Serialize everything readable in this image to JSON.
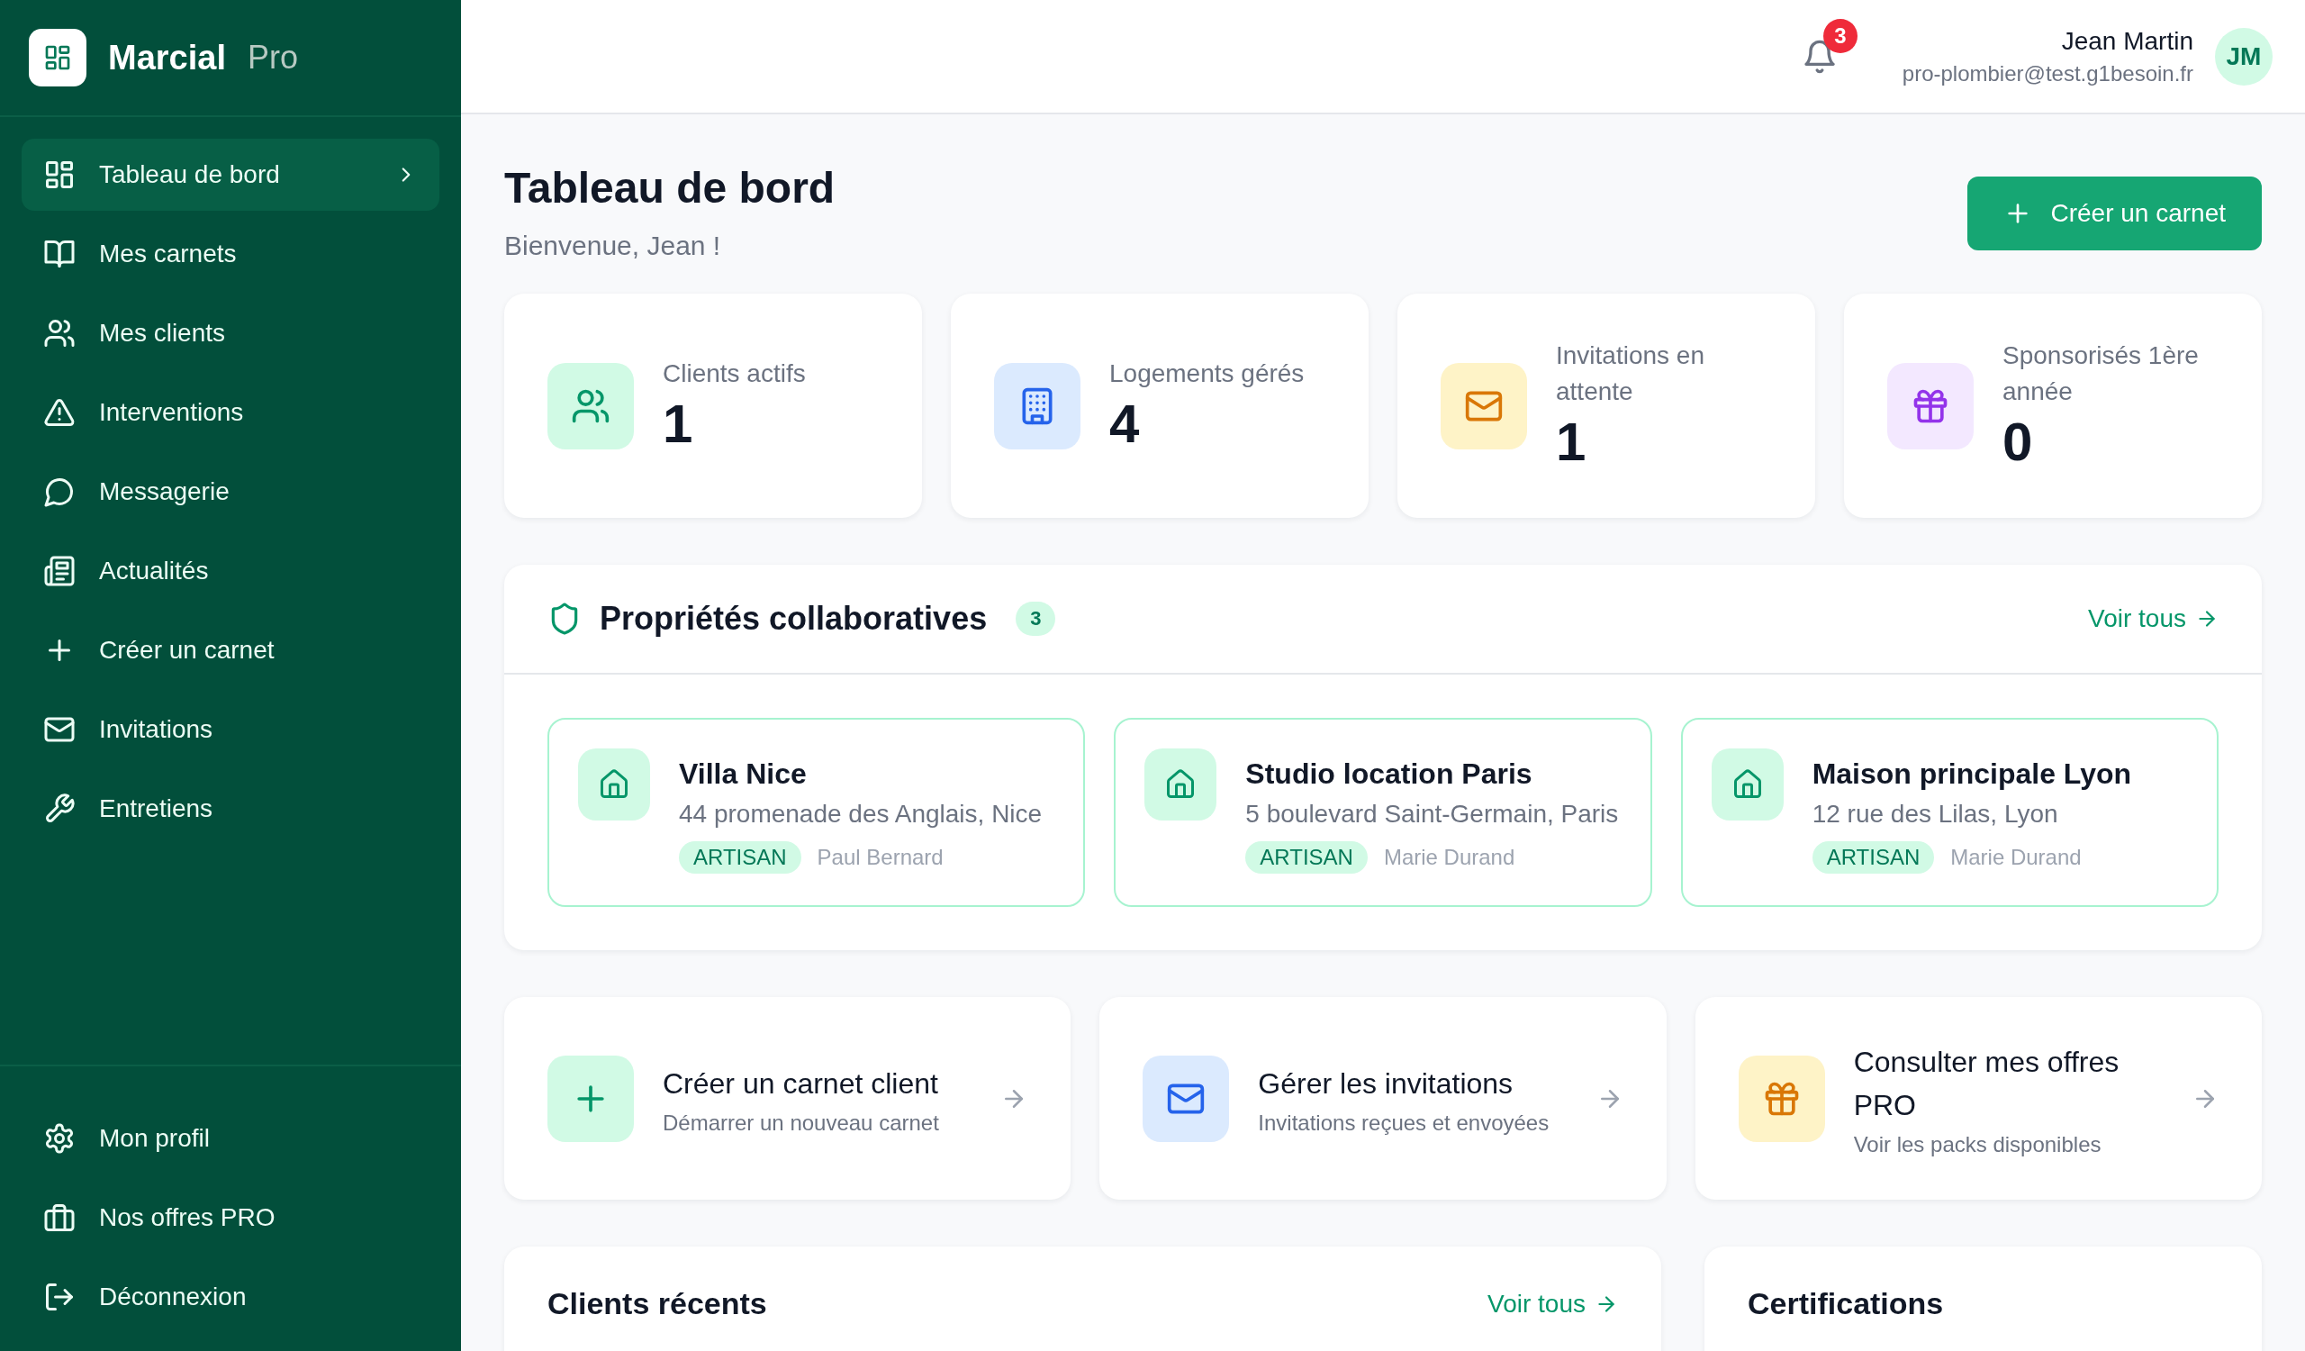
{
  "sidebar": {
    "brand": {
      "name": "Marcial",
      "suffix": "Pro"
    },
    "nav": [
      {
        "label": "Tableau de bord",
        "kind": "dashboard",
        "selected": true
      },
      {
        "label": "Mes carnets",
        "kind": "book",
        "selected": false
      },
      {
        "label": "Mes clients",
        "kind": "users",
        "selected": false
      },
      {
        "label": "Interventions",
        "kind": "alert",
        "selected": false
      },
      {
        "label": "Messagerie",
        "kind": "message",
        "selected": false
      },
      {
        "label": "Actualités",
        "kind": "news",
        "selected": false
      },
      {
        "label": "Créer un carnet",
        "kind": "plus",
        "selected": false
      },
      {
        "label": "Invitations",
        "kind": "mail",
        "selected": false
      },
      {
        "label": "Entretiens",
        "kind": "wrench",
        "selected": false
      }
    ],
    "footer": [
      {
        "label": "Mon profil",
        "kind": "settings"
      },
      {
        "label": "Nos offres PRO",
        "kind": "briefcase"
      },
      {
        "label": "Déconnexion",
        "kind": "logout"
      }
    ]
  },
  "topbar": {
    "notifications": "3",
    "user_name": "Jean Martin",
    "user_email": "pro-plombier@test.g1besoin.fr",
    "initials": "JM"
  },
  "page": {
    "title": "Tableau de bord",
    "subtitle": "Bienvenue, Jean !",
    "action": "Créer un carnet"
  },
  "stats": [
    {
      "label": "Clients actifs",
      "value": "1",
      "kind": "clients"
    },
    {
      "label": "Logements gérés",
      "value": "4",
      "kind": "housing"
    },
    {
      "label": "Invitations en attente",
      "value": "1",
      "kind": "invitations"
    },
    {
      "label": "Sponsorisés 1ère année",
      "value": "0",
      "kind": "sponsored"
    }
  ],
  "properties": {
    "title": "Propriétés collaboratives",
    "count": "3",
    "link": "Voir tous",
    "items": [
      {
        "name": "Villa Nice",
        "address": "44 promenade des Anglais, Nice",
        "role": "ARTISAN",
        "person": "Paul Bernard"
      },
      {
        "name": "Studio location Paris",
        "address": "5 boulevard Saint-Germain, Paris",
        "role": "ARTISAN",
        "person": "Marie Durand"
      },
      {
        "name": "Maison principale Lyon",
        "address": "12 rue des Lilas, Lyon",
        "role": "ARTISAN",
        "person": "Marie Durand"
      }
    ]
  },
  "quick_actions": [
    {
      "title": "Créer un carnet client",
      "subtitle": "Démarrer un nouveau carnet",
      "kind": "create"
    },
    {
      "title": "Gérer les invitations",
      "subtitle": "Invitations reçues et envoyées",
      "kind": "manage_invitations"
    },
    {
      "title": "Consulter mes offres PRO",
      "subtitle": "Voir les packs disponibles",
      "kind": "offers"
    }
  ],
  "bottom_panels": [
    {
      "title": "Clients récents",
      "link": "Voir tous"
    },
    {
      "title": "Certifications"
    }
  ]
}
